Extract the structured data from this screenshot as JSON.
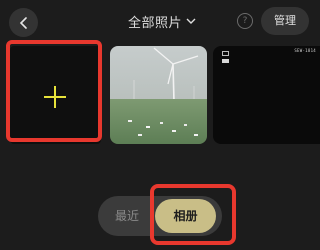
{
  "header": {
    "title": "全部照片",
    "help_glyph": "?",
    "manage_label": "管理",
    "icons": [
      "back-arrow-icon",
      "chevron-down-icon",
      "help-icon"
    ]
  },
  "grid": {
    "add_icon": "plus-icon",
    "screenshot_status_text": "SEW-1814"
  },
  "tabs": {
    "recent_label": "最近",
    "album_label": "相册",
    "active": "相册"
  },
  "colors": {
    "background": "#1c1c1c",
    "highlight": "#e8382e",
    "accent": "#c9be87",
    "plus": "#e6e23a"
  }
}
